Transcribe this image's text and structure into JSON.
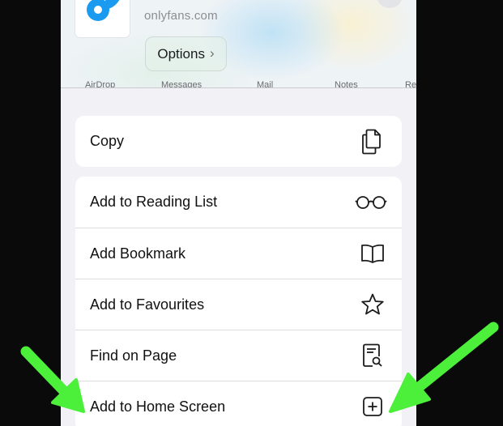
{
  "header": {
    "domain": "onlyfans.com",
    "options_label": "Options",
    "options_chevron": "›"
  },
  "share_targets": [
    "AirDrop",
    "Messages",
    "Mail",
    "Notes",
    "Re"
  ],
  "copy_group": {
    "items": [
      {
        "label": "Copy",
        "icon": "copy-icon"
      }
    ]
  },
  "actions_group": {
    "items": [
      {
        "label": "Add to Reading List",
        "icon": "glasses-icon"
      },
      {
        "label": "Add Bookmark",
        "icon": "book-icon"
      },
      {
        "label": "Add to Favourites",
        "icon": "star-icon"
      },
      {
        "label": "Find on Page",
        "icon": "find-icon"
      },
      {
        "label": "Add to Home Screen",
        "icon": "add-square-icon"
      }
    ]
  },
  "colors": {
    "arrow": "#4cf03a",
    "brand_blue": "#1a9bf0"
  }
}
